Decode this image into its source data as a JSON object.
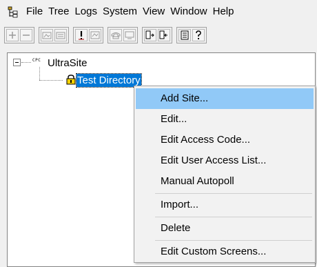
{
  "menubar": {
    "items": [
      "File",
      "Tree",
      "Logs",
      "System",
      "View",
      "Window",
      "Help"
    ]
  },
  "toolbar": {
    "groups": [
      [
        "add-icon",
        "remove-icon"
      ],
      [
        "site-icon",
        "site-list-icon"
      ],
      [
        "alarm-icon",
        "alarm-list-icon"
      ],
      [
        "phone-icon",
        "terminal-icon"
      ],
      [
        "connect-icon",
        "disconnect-icon"
      ],
      [
        "log-icon",
        "help-icon"
      ]
    ]
  },
  "tree": {
    "root_icon_text": "CPC",
    "root_label": "UltraSite",
    "child_label": "Test Directory"
  },
  "context_menu": {
    "items": [
      "Add Site...",
      "Edit...",
      "Edit Access Code...",
      "Edit User Access List...",
      "Manual Autopoll",
      "Import...",
      "Delete",
      "Edit Custom Screens..."
    ],
    "highlighted_index": 0
  },
  "colors": {
    "selection": "#0078d7",
    "menu_highlight": "#91c9f7"
  }
}
